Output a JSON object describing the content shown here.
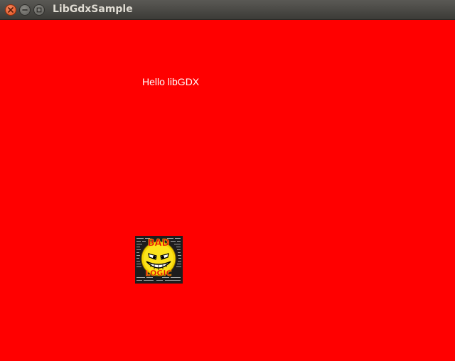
{
  "window": {
    "title": "LibGdxSample",
    "controls": {
      "close_icon": "close-icon",
      "minimize_icon": "minimize-icon",
      "maximize_icon": "maximize-icon"
    }
  },
  "canvas": {
    "background": "#ff0000",
    "text": "Hello libGDX",
    "text_color": "#ffffff",
    "image": {
      "name": "badlogic-logo",
      "lettering_top": "BAD",
      "lettering_bottom": "LOGIC"
    }
  }
}
